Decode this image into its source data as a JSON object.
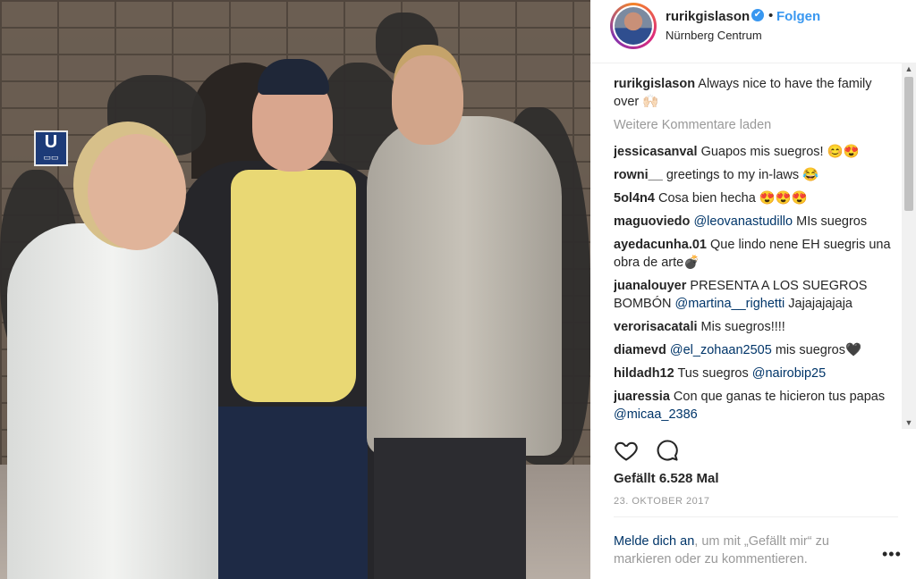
{
  "photo": {
    "sign_letter": "U",
    "sign_sub": "▭▭"
  },
  "header": {
    "username": "rurikgislason",
    "verified_icon": "✔",
    "separator": "•",
    "follow_label": "Folgen",
    "location": "Nürnberg Centrum"
  },
  "caption": {
    "user": "rurikgislason",
    "text": "Always nice to have the family over 🙌🏻"
  },
  "load_more": "Weitere Kommentare laden",
  "comments": [
    {
      "user": "jessicasanval",
      "text": "Guapos mis suegros! 😊😍"
    },
    {
      "user": "rowni__",
      "text": "greetings to my in-laws 😂"
    },
    {
      "user": "5ol4n4",
      "text": "Cosa bien hecha 😍😍😍"
    },
    {
      "user": "maguoviedo",
      "mention": "@leovanastudillo",
      "text": "MIs suegros"
    },
    {
      "user": "ayedacunha.01",
      "text": "Que lindo nene EH suegris una obra de arte💣"
    },
    {
      "user": "juanalouyer",
      "text": "PRESENTA A LOS SUEGROS BOMBÓN",
      "mention": "@martina__righetti",
      "text2": "Jajajajajaja"
    },
    {
      "user": "verorisacatali",
      "text": "Mis suegros!!!!"
    },
    {
      "user": "diamevd",
      "mention": "@el_zohaan2505",
      "text": "mis suegros🖤"
    },
    {
      "user": "hildadh12",
      "text": "Tus suegros",
      "mention": "@nairobip25"
    },
    {
      "user": "juaressia",
      "text": "Con que ganas te hicieron tus papas",
      "mention": "@micaa_2386"
    }
  ],
  "scrollbar": {
    "up": "▲",
    "down": "▼"
  },
  "actions": {
    "like_icon": "heart-icon",
    "comment_icon": "comment-bubble-icon"
  },
  "likes": "Gefällt 6.528 Mal",
  "date": "23. OKTOBER 2017",
  "login": {
    "link": "Melde dich an",
    "text": ", um mit „Gefällt mir“ zu markieren oder zu kommentieren."
  },
  "more_label": "•••",
  "colors": {
    "accent": "#3897f0",
    "mention": "#003569",
    "muted": "#999999"
  }
}
